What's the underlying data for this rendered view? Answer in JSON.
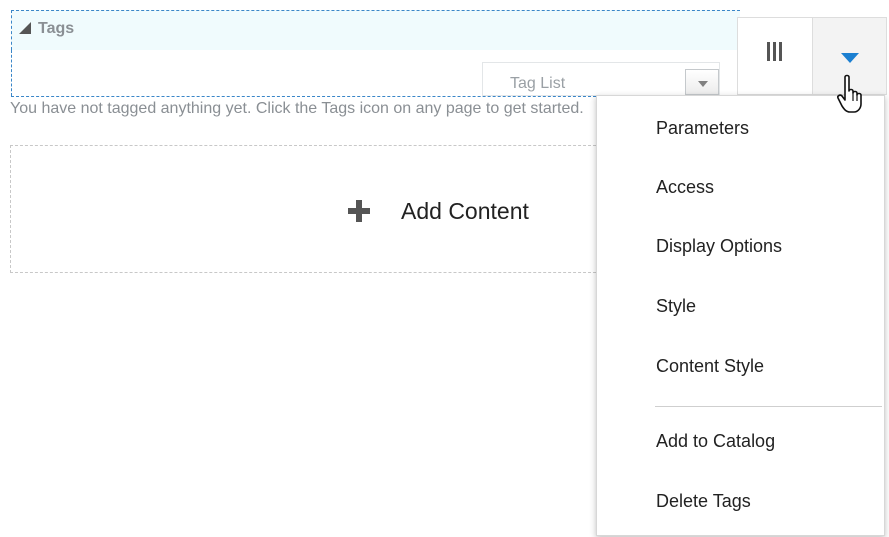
{
  "tags_portlet": {
    "title": "Tags",
    "tag_list_placeholder": "Tag List",
    "empty_message": "You have not tagged anything yet. Click the Tags icon on any page to get started."
  },
  "add_content": {
    "label": "Add Content"
  },
  "toolbar": {
    "layout_icon": "columns-icon",
    "menu_icon": "dropdown-triangle-icon"
  },
  "menu": {
    "items": [
      "Parameters",
      "Access",
      "Display Options",
      "Style",
      "Content Style",
      "Add to Catalog",
      "Delete Tags"
    ]
  },
  "colors": {
    "accent": "#1b7fd1",
    "selection_border": "#3a86c8",
    "header_bg": "#f0fbfd"
  }
}
